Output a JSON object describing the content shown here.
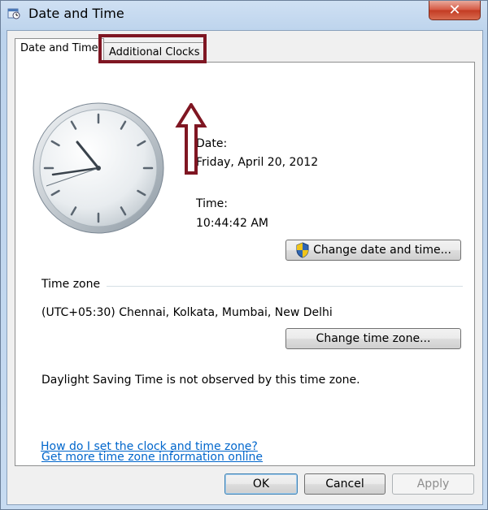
{
  "window": {
    "title": "Date and Time",
    "close_symbol": "✕"
  },
  "tabs": [
    {
      "label": "Date and Time",
      "selected": true
    },
    {
      "label": "Additional Clocks",
      "selected": false
    }
  ],
  "annotation": {
    "highlight_color": "#7f1622"
  },
  "datetime": {
    "date_label": "Date:",
    "date_value": "Friday, April 20, 2012",
    "time_label": "Time:",
    "time_value": "10:44:42 AM",
    "change_button": "Change date and time..."
  },
  "timezone": {
    "heading": "Time zone",
    "value": "(UTC+05:30) Chennai, Kolkata, Mumbai, New Delhi",
    "change_button": "Change time zone...",
    "dst_note": "Daylight Saving Time is not observed by this time zone."
  },
  "links": [
    "Get more time zone information online",
    "How do I set the clock and time zone?"
  ],
  "footer": {
    "ok": "OK",
    "cancel": "Cancel",
    "apply": "Apply",
    "apply_enabled": false
  },
  "colors": {
    "link": "#0066cc",
    "annotation": "#7f1622"
  },
  "icons": {
    "app": "date-time-app-icon",
    "shield": "uac-shield-icon",
    "close": "close-icon"
  }
}
